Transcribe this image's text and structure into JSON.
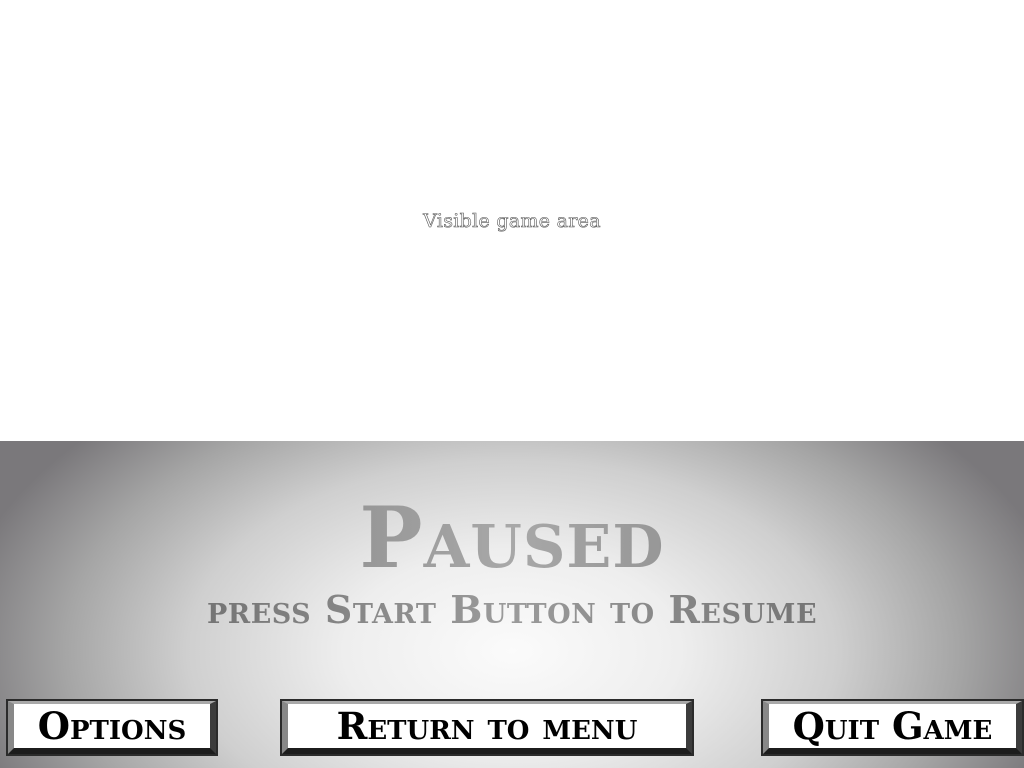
{
  "game_area": {
    "label": "Visible game area"
  },
  "pause_menu": {
    "title": "Paused",
    "subtitle": "press Start Button to Resume",
    "buttons": {
      "options": "Options",
      "return_to_menu": "Return to menu",
      "quit_game": "Quit Game"
    }
  },
  "colors": {
    "panel_center": "#fbfbfb",
    "panel_edge": "#7a787b",
    "title_text": "#8a8a8a",
    "button_bg": "#ffffff",
    "button_text": "#000000",
    "button_border": "#3c3c3c"
  }
}
